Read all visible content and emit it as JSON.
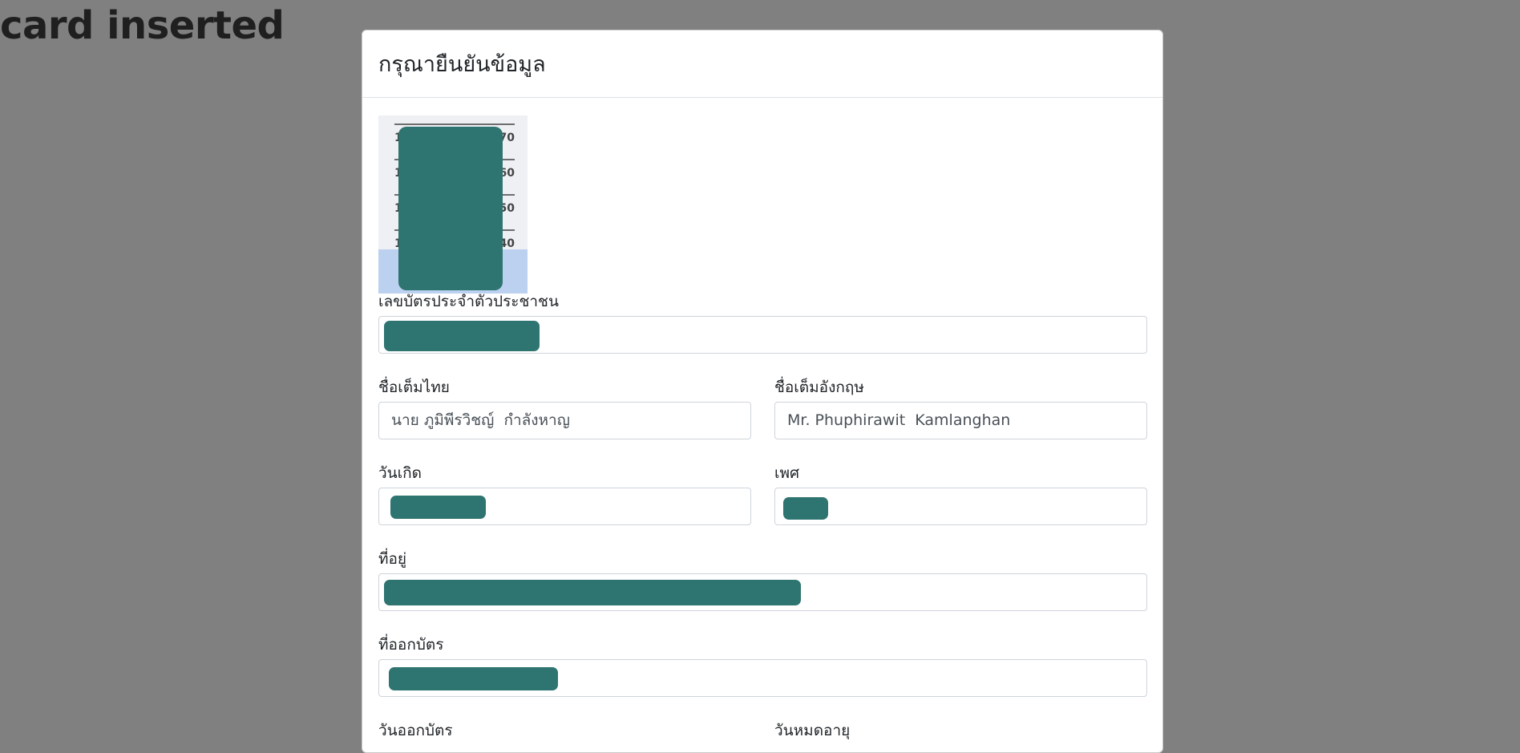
{
  "background": {
    "heading": "card inserted"
  },
  "modal": {
    "title": "กรุณายืนยันข้อมูล",
    "fields": {
      "id_number": {
        "label": "เลขบัตรประจำตัวประชาชน",
        "value": ""
      },
      "name_th": {
        "label": "ชื่อเต็มไทย",
        "value": "นาย ภูมิพีรวิชญ์  กำลังหาญ"
      },
      "name_en": {
        "label": "ชื่อเต็มอังกฤษ",
        "value": "Mr. Phuphirawit  Kamlanghan"
      },
      "birth_date": {
        "label": "วันเกิด",
        "value": ""
      },
      "gender": {
        "label": "เพศ",
        "value": ""
      },
      "address": {
        "label": "ที่อยู่",
        "value": ""
      },
      "issuer": {
        "label": "ที่ออกบัตร",
        "value": ""
      },
      "issue_date": {
        "label": "วันออกบัตร"
      },
      "expiry_date": {
        "label": "วันหมดอายุ"
      }
    },
    "photo": {
      "ruler_numbers": [
        "1",
        "170",
        "1",
        "160",
        "1",
        "150",
        "1",
        "140"
      ]
    }
  },
  "colors": {
    "overlay": "#808080",
    "redaction": "#2e7470",
    "border": "#ced4da"
  }
}
